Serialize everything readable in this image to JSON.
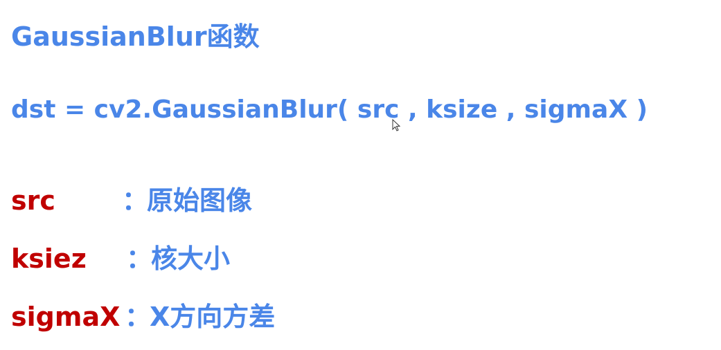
{
  "title": "GaussianBlur函数",
  "signature": "dst = cv2.GaussianBlur( src , ksize , sigmaX )",
  "params": [
    {
      "name": "src",
      "colon": "：",
      "desc": "原始图像"
    },
    {
      "name": "ksiez",
      "colon": "：",
      "desc": "核大小"
    },
    {
      "name": "sigmaX",
      "colon": "：",
      "desc": "X方向方差"
    }
  ],
  "colors": {
    "heading_blue": "#4a86e8",
    "param_red": "#c00000",
    "background": "#ffffff"
  },
  "icons": {
    "cursor": "mouse-pointer-icon"
  }
}
